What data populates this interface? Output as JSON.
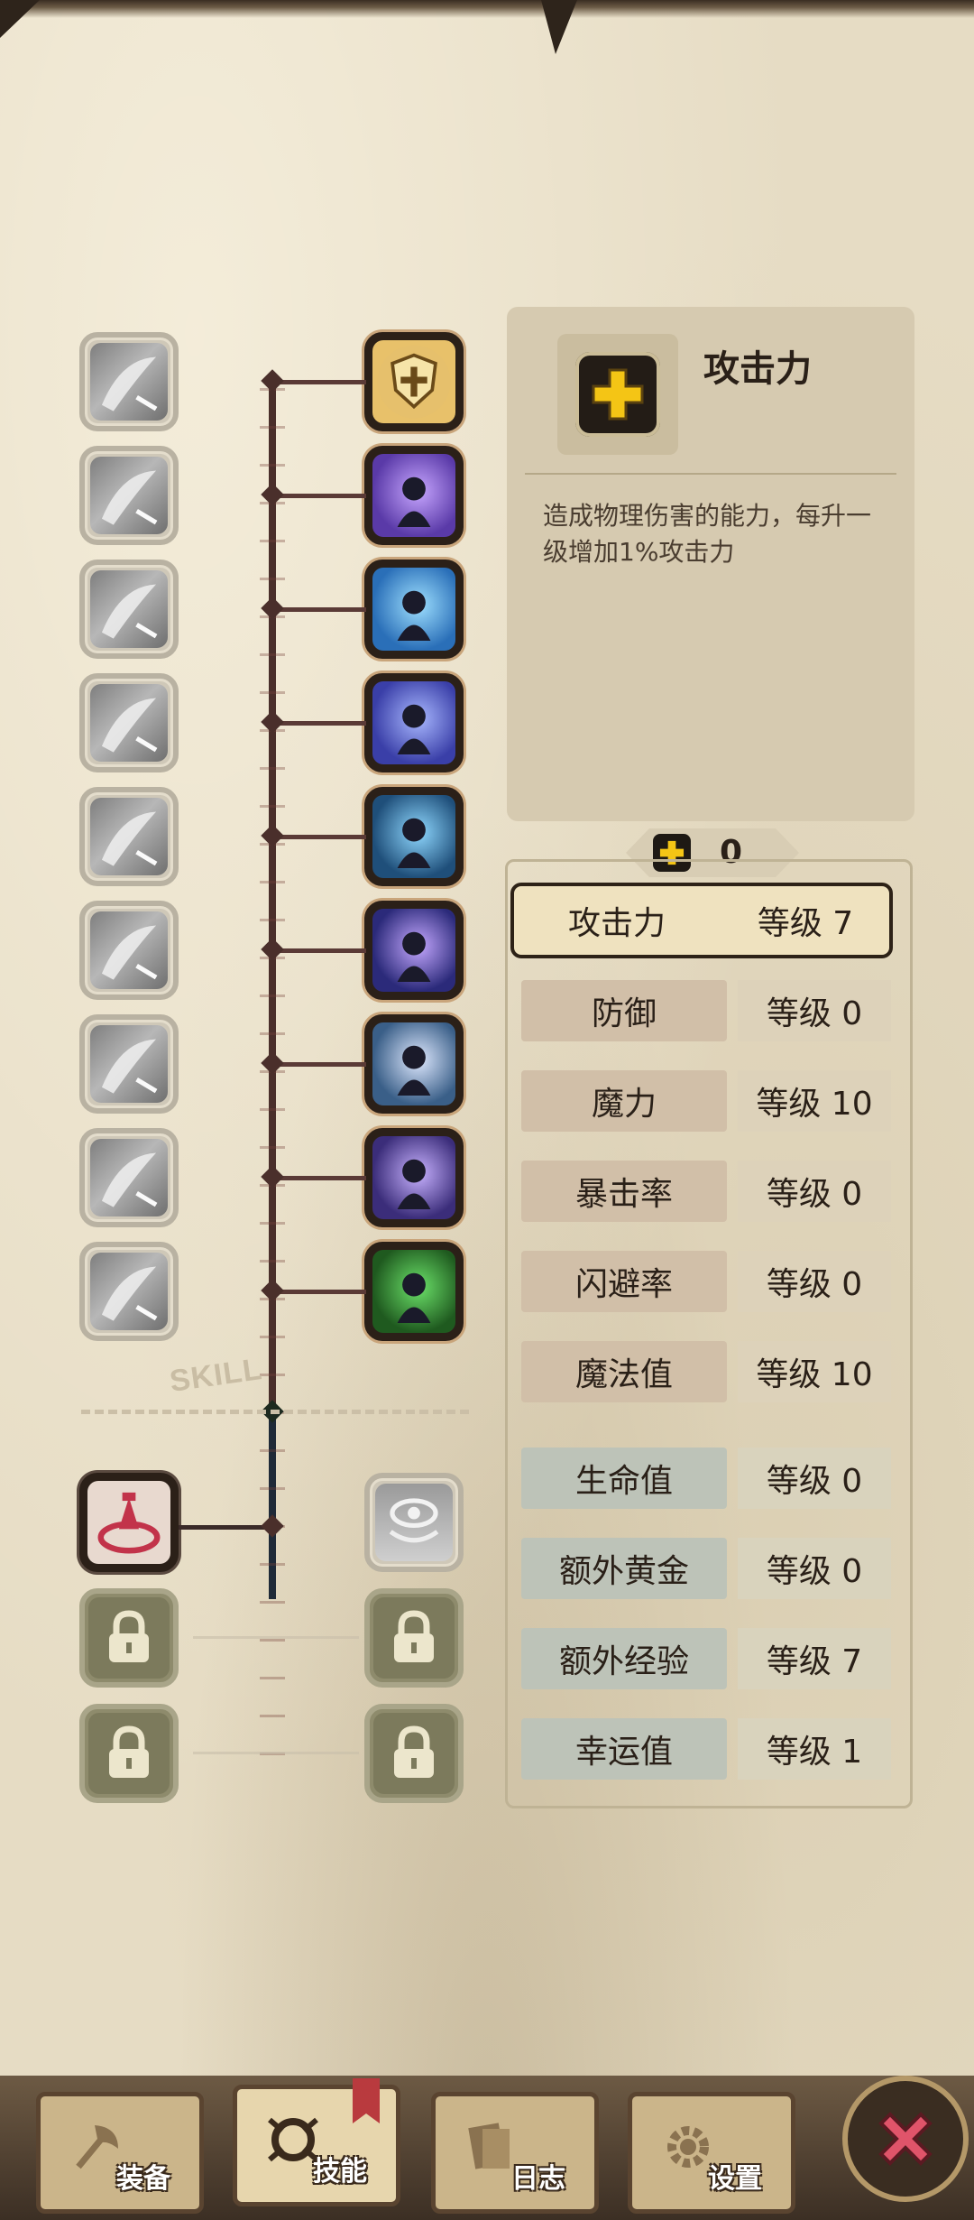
{
  "left_column_icons": [
    "sword-slash-icon",
    "stick-figure-fight-icon",
    "dragon-head-icon",
    "flexing-arm-icon",
    "dash-strike-icon",
    "sword-stab-icon",
    "shadow-fighter-icon",
    "explosion-icon",
    "crossed-swords-icon"
  ],
  "right_column_icons": [
    "shield-cross-icon",
    "magic-punch-icon",
    "lightning-figure-icon",
    "speed-runner-icon",
    "frost-figure-icon",
    "evil-eye-icon",
    "whirlwind-blade-icon",
    "moon-orb-icon",
    "green-plus-figure-icon"
  ],
  "skill_label": "SKILL",
  "locked_skills": {
    "left_unlocked_icon": "red-cauldron-icon",
    "right_unlocked_icon": "eye-bowl-icon",
    "locked_icon": "lock-icon"
  },
  "info": {
    "icon": "plus-icon",
    "title": "攻击力",
    "description": "造成物理伤害的能力，每升一级增加1%攻击力"
  },
  "points": {
    "icon": "plus-icon",
    "value": "0"
  },
  "stats": [
    {
      "name": "攻击力",
      "level": "等级 7",
      "group": "red",
      "selected": true
    },
    {
      "name": "防御",
      "level": "等级 0",
      "group": "red",
      "selected": false
    },
    {
      "name": "魔力",
      "level": "等级 10",
      "group": "red",
      "selected": false
    },
    {
      "name": "暴击率",
      "level": "等级 0",
      "group": "red",
      "selected": false
    },
    {
      "name": "闪避率",
      "level": "等级 0",
      "group": "red",
      "selected": false
    },
    {
      "name": "魔法值",
      "level": "等级 10",
      "group": "red",
      "selected": false
    },
    {
      "name": "生命值",
      "level": "等级 0",
      "group": "blue",
      "selected": false
    },
    {
      "name": "额外黄金",
      "level": "等级 0",
      "group": "blue",
      "selected": false
    },
    {
      "name": "额外经验",
      "level": "等级 7",
      "group": "blue",
      "selected": false
    },
    {
      "name": "幸运值",
      "level": "等级 1",
      "group": "blue",
      "selected": false
    }
  ],
  "nav": [
    {
      "label": "装备",
      "icon": "axe-icon",
      "active": false
    },
    {
      "label": "技能",
      "icon": "skill-ring-icon",
      "active": true
    },
    {
      "label": "日志",
      "icon": "journal-icon",
      "active": false
    },
    {
      "label": "设置",
      "icon": "gear-icon",
      "active": false
    }
  ],
  "close_icon": "close-x-icon",
  "colors": {
    "accent_red": "#c2334a",
    "panel": "#d6cab0",
    "line": "#4a2f2b",
    "gold_plus": "#f4c515"
  }
}
